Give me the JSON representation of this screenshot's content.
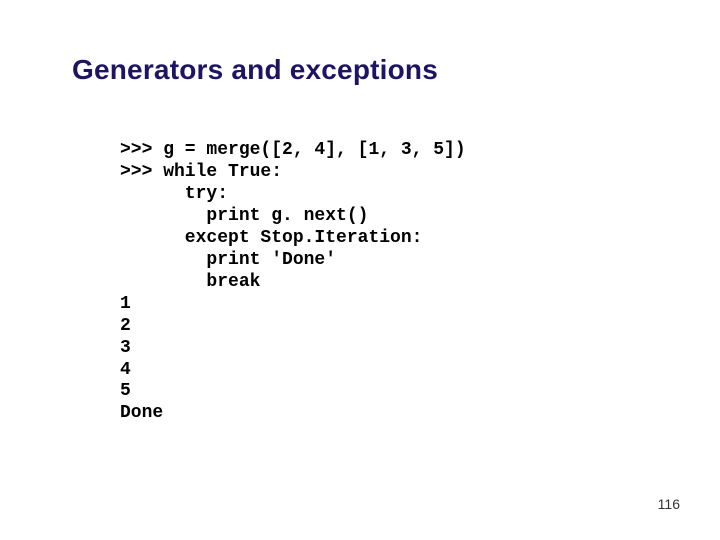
{
  "title": "Generators and exceptions",
  "code": ">>> g = merge([2, 4], [1, 3, 5])\n>>> while True:\n      try:\n        print g. next()\n      except Stop.Iteration:\n        print 'Done'\n        break\n1\n2\n3\n4\n5\nDone",
  "page_number": "116"
}
